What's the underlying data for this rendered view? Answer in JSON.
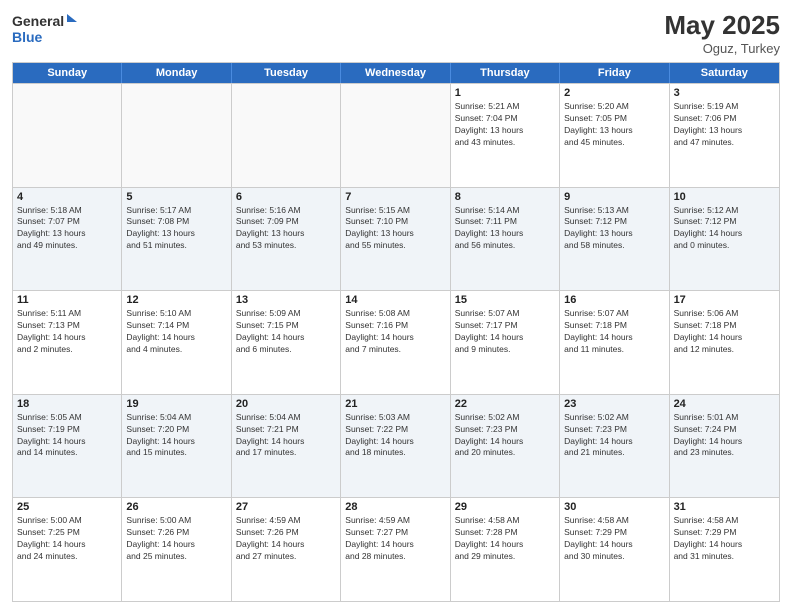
{
  "header": {
    "logo_line1": "General",
    "logo_line2": "Blue",
    "month_year": "May 2025",
    "location": "Oguz, Turkey"
  },
  "days_of_week": [
    "Sunday",
    "Monday",
    "Tuesday",
    "Wednesday",
    "Thursday",
    "Friday",
    "Saturday"
  ],
  "weeks": [
    [
      {
        "day": "",
        "info": ""
      },
      {
        "day": "",
        "info": ""
      },
      {
        "day": "",
        "info": ""
      },
      {
        "day": "",
        "info": ""
      },
      {
        "day": "1",
        "info": "Sunrise: 5:21 AM\nSunset: 7:04 PM\nDaylight: 13 hours\nand 43 minutes."
      },
      {
        "day": "2",
        "info": "Sunrise: 5:20 AM\nSunset: 7:05 PM\nDaylight: 13 hours\nand 45 minutes."
      },
      {
        "day": "3",
        "info": "Sunrise: 5:19 AM\nSunset: 7:06 PM\nDaylight: 13 hours\nand 47 minutes."
      }
    ],
    [
      {
        "day": "4",
        "info": "Sunrise: 5:18 AM\nSunset: 7:07 PM\nDaylight: 13 hours\nand 49 minutes."
      },
      {
        "day": "5",
        "info": "Sunrise: 5:17 AM\nSunset: 7:08 PM\nDaylight: 13 hours\nand 51 minutes."
      },
      {
        "day": "6",
        "info": "Sunrise: 5:16 AM\nSunset: 7:09 PM\nDaylight: 13 hours\nand 53 minutes."
      },
      {
        "day": "7",
        "info": "Sunrise: 5:15 AM\nSunset: 7:10 PM\nDaylight: 13 hours\nand 55 minutes."
      },
      {
        "day": "8",
        "info": "Sunrise: 5:14 AM\nSunset: 7:11 PM\nDaylight: 13 hours\nand 56 minutes."
      },
      {
        "day": "9",
        "info": "Sunrise: 5:13 AM\nSunset: 7:12 PM\nDaylight: 13 hours\nand 58 minutes."
      },
      {
        "day": "10",
        "info": "Sunrise: 5:12 AM\nSunset: 7:12 PM\nDaylight: 14 hours\nand 0 minutes."
      }
    ],
    [
      {
        "day": "11",
        "info": "Sunrise: 5:11 AM\nSunset: 7:13 PM\nDaylight: 14 hours\nand 2 minutes."
      },
      {
        "day": "12",
        "info": "Sunrise: 5:10 AM\nSunset: 7:14 PM\nDaylight: 14 hours\nand 4 minutes."
      },
      {
        "day": "13",
        "info": "Sunrise: 5:09 AM\nSunset: 7:15 PM\nDaylight: 14 hours\nand 6 minutes."
      },
      {
        "day": "14",
        "info": "Sunrise: 5:08 AM\nSunset: 7:16 PM\nDaylight: 14 hours\nand 7 minutes."
      },
      {
        "day": "15",
        "info": "Sunrise: 5:07 AM\nSunset: 7:17 PM\nDaylight: 14 hours\nand 9 minutes."
      },
      {
        "day": "16",
        "info": "Sunrise: 5:07 AM\nSunset: 7:18 PM\nDaylight: 14 hours\nand 11 minutes."
      },
      {
        "day": "17",
        "info": "Sunrise: 5:06 AM\nSunset: 7:18 PM\nDaylight: 14 hours\nand 12 minutes."
      }
    ],
    [
      {
        "day": "18",
        "info": "Sunrise: 5:05 AM\nSunset: 7:19 PM\nDaylight: 14 hours\nand 14 minutes."
      },
      {
        "day": "19",
        "info": "Sunrise: 5:04 AM\nSunset: 7:20 PM\nDaylight: 14 hours\nand 15 minutes."
      },
      {
        "day": "20",
        "info": "Sunrise: 5:04 AM\nSunset: 7:21 PM\nDaylight: 14 hours\nand 17 minutes."
      },
      {
        "day": "21",
        "info": "Sunrise: 5:03 AM\nSunset: 7:22 PM\nDaylight: 14 hours\nand 18 minutes."
      },
      {
        "day": "22",
        "info": "Sunrise: 5:02 AM\nSunset: 7:23 PM\nDaylight: 14 hours\nand 20 minutes."
      },
      {
        "day": "23",
        "info": "Sunrise: 5:02 AM\nSunset: 7:23 PM\nDaylight: 14 hours\nand 21 minutes."
      },
      {
        "day": "24",
        "info": "Sunrise: 5:01 AM\nSunset: 7:24 PM\nDaylight: 14 hours\nand 23 minutes."
      }
    ],
    [
      {
        "day": "25",
        "info": "Sunrise: 5:00 AM\nSunset: 7:25 PM\nDaylight: 14 hours\nand 24 minutes."
      },
      {
        "day": "26",
        "info": "Sunrise: 5:00 AM\nSunset: 7:26 PM\nDaylight: 14 hours\nand 25 minutes."
      },
      {
        "day": "27",
        "info": "Sunrise: 4:59 AM\nSunset: 7:26 PM\nDaylight: 14 hours\nand 27 minutes."
      },
      {
        "day": "28",
        "info": "Sunrise: 4:59 AM\nSunset: 7:27 PM\nDaylight: 14 hours\nand 28 minutes."
      },
      {
        "day": "29",
        "info": "Sunrise: 4:58 AM\nSunset: 7:28 PM\nDaylight: 14 hours\nand 29 minutes."
      },
      {
        "day": "30",
        "info": "Sunrise: 4:58 AM\nSunset: 7:29 PM\nDaylight: 14 hours\nand 30 minutes."
      },
      {
        "day": "31",
        "info": "Sunrise: 4:58 AM\nSunset: 7:29 PM\nDaylight: 14 hours\nand 31 minutes."
      }
    ]
  ]
}
